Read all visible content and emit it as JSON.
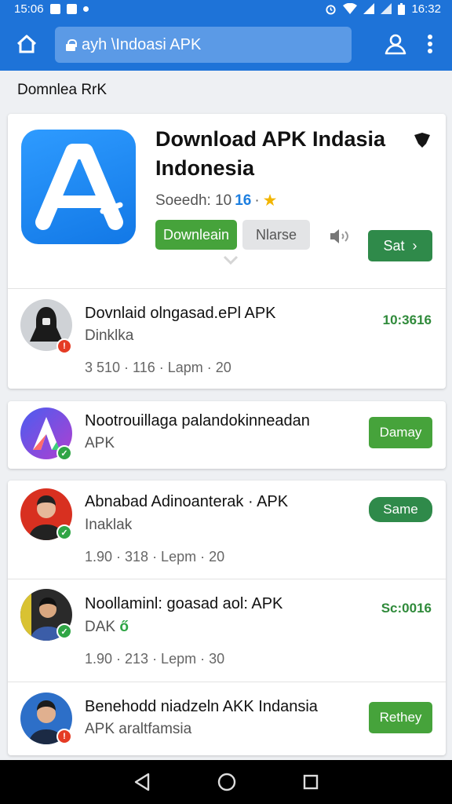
{
  "status": {
    "left_time": "15:06",
    "right_time": "16:32"
  },
  "toolbar": {
    "url": "ayh \\Indoasi APK"
  },
  "section_label": "Domnlea RrK",
  "hero": {
    "title": "Download APK Indasia Indonesia",
    "rating_label": "Soeedh: 10",
    "rating_value": "16",
    "rating_sep": "·",
    "download_label": "Downleain",
    "secondary_label": "Nlarse",
    "share_label": "Sat",
    "brand_color": "#1e73d8",
    "accent_green": "#46a33b"
  },
  "list1": [
    {
      "title": "Dovnlaid olngasad.ePl APK",
      "subtitle": "Dinklka",
      "meta": "3 510 · 116 · Lapm · 20",
      "time": "10:3616",
      "avatar": "hooded-figure",
      "badge": "red"
    }
  ],
  "list2": [
    {
      "title": "Nootrouillaga palandokinneadan",
      "subtitle": "APK",
      "button": "Damay",
      "avatar": "colorful-a-logo",
      "badge": "green"
    }
  ],
  "list3": [
    {
      "title": "Abnabad Adinoanterak · APK",
      "subtitle": "Inaklak",
      "meta": "1.90 · 318 · Lepm · 20",
      "button": "Same",
      "badge": "green"
    },
    {
      "title": "Noollaminl: goasad aol: APK",
      "subtitle": "DAK",
      "meta": "1.90 · 213 · Lepm · 30",
      "time": "Sc:0016",
      "badge": "green"
    },
    {
      "title": "Benehodd niadzeln AKK Indansia",
      "subtitle": "APK araltfamsia",
      "button": "Rethey",
      "badge": "red"
    }
  ]
}
